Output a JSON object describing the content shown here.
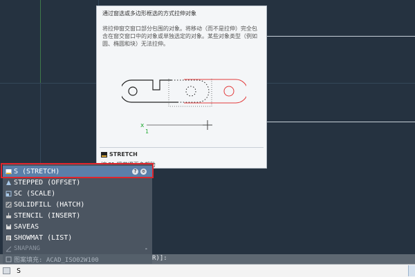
{
  "tooltip": {
    "title": "通过窗选或多边形框选的方式拉伸对象",
    "description": "将拉伸窗交窗口部分包围的对象。将移动（而不是拉伸）完全包含在窗交窗口中的对象或单独选定的对象。某些对象类型（例如圆、椭圆和块）无法拉伸。",
    "command_name": "STRETCH",
    "help_hint": "按 F1 键获得更多帮助",
    "illustration_label": "1",
    "icon": "stretch-command-icon"
  },
  "autocomplete": {
    "items": [
      {
        "label": "S (STRETCH)",
        "icon": "stretch-icon",
        "selected": true
      },
      {
        "label": "STEPPED (OFFSET)",
        "icon": "offset-icon",
        "selected": false
      },
      {
        "label": "SC (SCALE)",
        "icon": "scale-icon",
        "selected": false
      },
      {
        "label": "SOLIDFILL (HATCH)",
        "icon": "hatch-icon",
        "selected": false
      },
      {
        "label": "STENCIL (INSERT)",
        "icon": "insert-icon",
        "selected": false
      },
      {
        "label": "SAVEAS",
        "icon": "saveas-icon",
        "selected": false
      },
      {
        "label": "SHOWMAT (LIST)",
        "icon": "list-icon",
        "selected": false
      },
      {
        "label": "SNAPANG",
        "icon": "snapang-icon",
        "selected": false
      }
    ],
    "help_button": "?",
    "settings_button": "gear-icon"
  },
  "command_history": {
    "autocomplete_item": "图案填充: ACAD_ISO02W100",
    "text": "R)]:"
  },
  "command_line": {
    "value": "S",
    "icon": "command-line-icon"
  },
  "colors": {
    "canvas": "#253240",
    "selection": "#5b7fa9",
    "highlight_frame": "#e0252c",
    "illustration_red": "#e23a3a",
    "axis_green": "#22aa33"
  }
}
